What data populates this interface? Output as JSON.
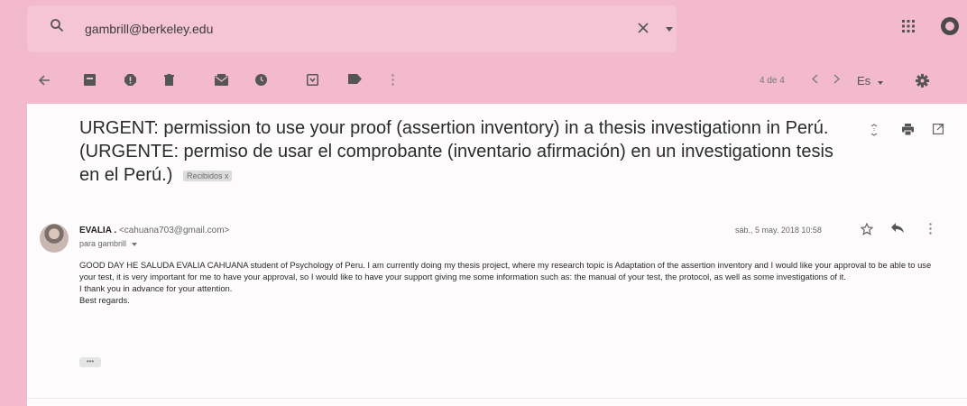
{
  "search": {
    "value": "gambrill@berkeley.edu"
  },
  "toolbar": {
    "icons": [
      "back-arrow-icon",
      "archive-icon",
      "report-spam-icon",
      "delete-icon",
      "mark-unread-icon",
      "snooze-icon",
      "move-to-icon",
      "label-icon",
      "more-vert-icon"
    ],
    "pagination": "4 de 4",
    "language": "Es"
  },
  "email": {
    "subject": "URGENT: permission to use your proof (assertion inventory) in a thesis investigationn in Perú. (URGENTE: permiso de usar el comprobante (inventario afirmación) en un investigationn tesis en el Perú.)",
    "label_chip": "Recibidos x",
    "sender_name": "EVALIA .",
    "sender_email": "<cahuana703@gmail.com>",
    "recipient": "para gambrill",
    "date": "sáb., 5 may. 2018 10:58",
    "body": {
      "paragraph": "GOOD DAY HE SALUDA EVALIA CAHUANA student of Psychology of Peru. I am currently doing my thesis project, where my research topic is Adaptation of the assertion inventory and I would like your approval to be able to use your test, it is very important for me to have your approval, so I would like to have your support giving me some information such as: the manual of your test, the protocol, as well as some investigations of it.",
      "thanks": "I thank you in advance for your attention.",
      "closing": "Best regards."
    },
    "ellipsis": "•••"
  }
}
